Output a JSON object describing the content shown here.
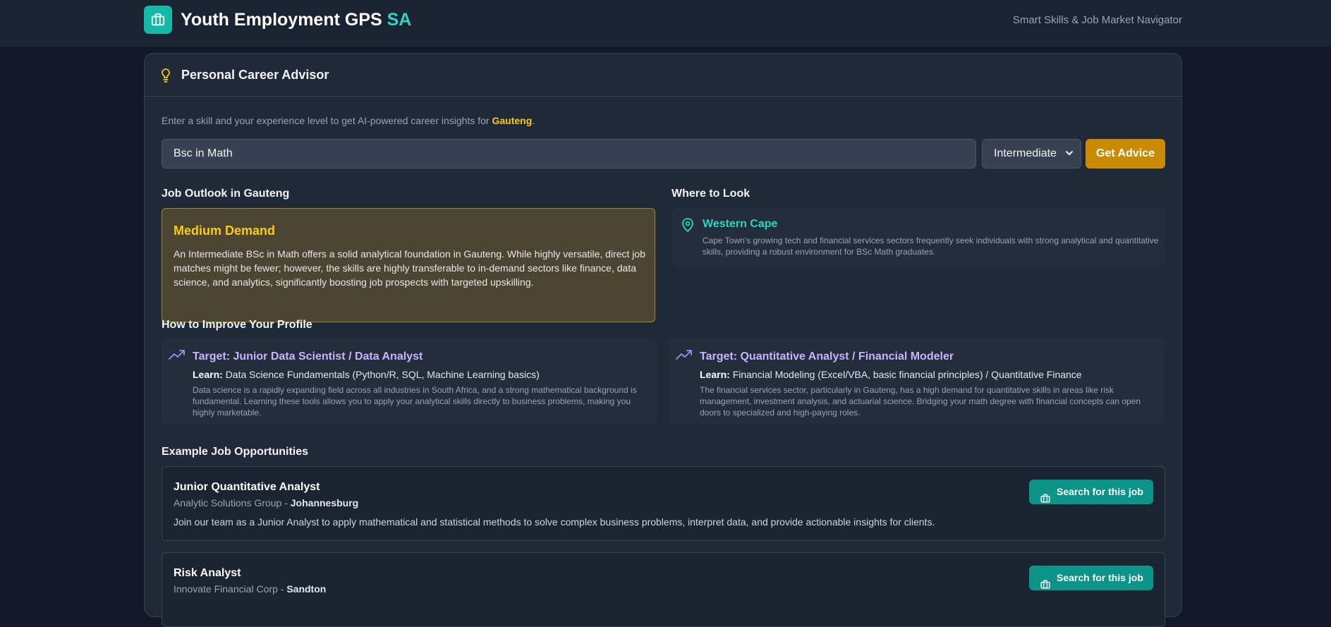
{
  "header": {
    "title_main": "Youth Employment GPS",
    "title_accent": "SA",
    "tagline": "Smart Skills & Job Market Navigator",
    "logo_icon": "briefcase-icon",
    "accent_color": "#2dd4bf"
  },
  "advisor": {
    "title": "Personal Career Advisor",
    "title_icon": "lightbulb-icon",
    "intro_text": "Enter a skill and your experience level to get AI-powered career insights for",
    "location": "Gauteng",
    "intro_suffix": ".",
    "skill_value": "Bsc in Math",
    "level_value": "Intermediate",
    "submit_label": "Get Advice"
  },
  "outlook": {
    "heading": "Job Outlook in Gauteng",
    "level": "Medium Demand",
    "description": "An Intermediate BSc in Math offers a solid analytical foundation in Gauteng. While highly versatile, direct job matches might be fewer; however, the skills are highly transferable to in-demand sectors like finance, data science, and analytics, significantly boosting job prospects with targeted upskilling."
  },
  "where": {
    "heading": "Where to Look",
    "region": "Western Cape",
    "icon": "map-pin-icon",
    "description": "Cape Town's growing tech and financial services sectors frequently seek individuals with strong analytical and quantitative skills, providing a robust environment for BSc Math graduates."
  },
  "improve": {
    "heading": "How to Improve Your Profile",
    "icon": "trending-up-icon",
    "learn_label": "Learn:",
    "items": [
      {
        "target": "Target: Junior Data Scientist / Data Analyst",
        "learn": "Data Science Fundamentals (Python/R, SQL, Machine Learning basics)",
        "description": "Data science is a rapidly expanding field across all industries in South Africa, and a strong mathematical background is fundamental. Learning these tools allows you to apply your analytical skills directly to business problems, making you highly marketable."
      },
      {
        "target": "Target: Quantitative Analyst / Financial Modeler",
        "learn": "Financial Modeling (Excel/VBA, basic financial principles) / Quantitative Finance",
        "description": "The financial services sector, particularly in Gauteng, has a high demand for quantitative skills in areas like risk management, investment analysis, and actuarial science. Bridging your math degree with financial concepts can open doors to specialized and high-paying roles."
      }
    ]
  },
  "jobs": {
    "heading": "Example Job Opportunities",
    "button_label": "Search for this job",
    "items": [
      {
        "title": "Junior Quantitative Analyst",
        "company": "Analytic Solutions Group",
        "separator": " - ",
        "location": "Johannesburg",
        "description": "Join our team as a Junior Analyst to apply mathematical and statistical methods to solve complex business problems, interpret data, and provide actionable insights for clients."
      },
      {
        "title": "Risk Analyst",
        "company": "Innovate Financial Corp",
        "separator": " - ",
        "location": "Sandton",
        "description": ""
      }
    ]
  }
}
